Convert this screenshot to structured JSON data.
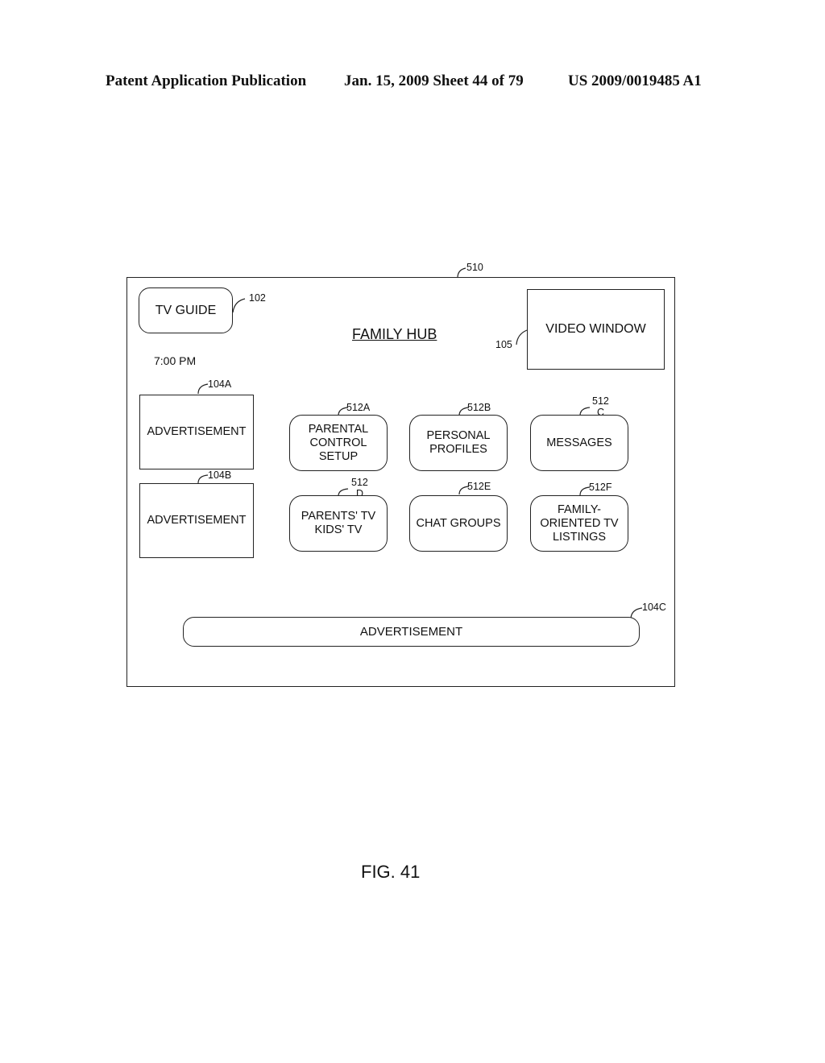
{
  "header": {
    "publication": "Patent Application Publication",
    "date_sheet": "Jan. 15, 2009  Sheet 44 of 79",
    "patent_number": "US 2009/0019485 A1"
  },
  "screen": {
    "ref": "510",
    "title": "FAMILY HUB",
    "tv_guide": {
      "label": "TV GUIDE",
      "ref": "102"
    },
    "time": "7:00 PM",
    "video_window": {
      "label": "VIDEO WINDOW",
      "ref": "105"
    },
    "ads": [
      {
        "label": "ADVERTISEMENT",
        "ref": "104A"
      },
      {
        "label": "ADVERTISEMENT",
        "ref": "104B"
      },
      {
        "label": "ADVERTISEMENT",
        "ref": "104C"
      }
    ],
    "buttons": [
      {
        "lines": [
          "PARENTAL",
          "CONTROL",
          "SETUP"
        ],
        "ref": "512A"
      },
      {
        "lines": [
          "PERSONAL",
          "PROFILES"
        ],
        "ref": "512B"
      },
      {
        "lines": [
          "MESSAGES"
        ],
        "ref": "512",
        "ref_suffix": "C"
      },
      {
        "lines": [
          "PARENTS' TV",
          "KIDS' TV"
        ],
        "ref": "512",
        "ref_suffix": "D"
      },
      {
        "lines": [
          "CHAT GROUPS"
        ],
        "ref": "512E"
      },
      {
        "lines": [
          "FAMILY-",
          "ORIENTED TV",
          "LISTINGS"
        ],
        "ref": "512F"
      }
    ]
  },
  "figure_label": "FIG. 41"
}
